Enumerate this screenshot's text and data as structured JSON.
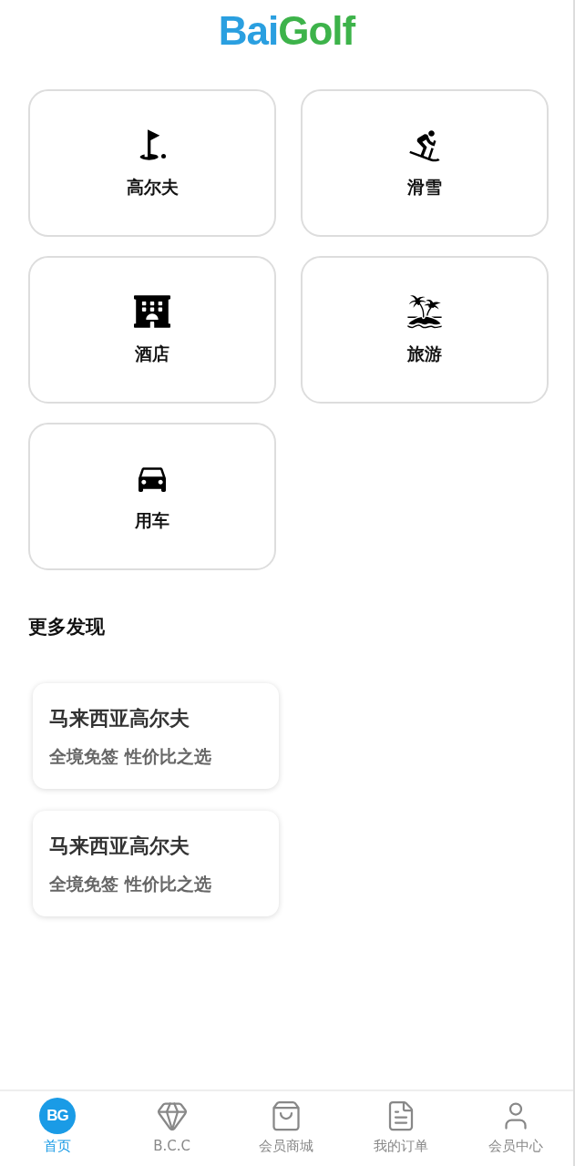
{
  "logo": [
    {
      "text": "Bai",
      "color": "#2a9fe0"
    },
    {
      "text": "Golf",
      "color": "#3db34a"
    }
  ],
  "categories": [
    {
      "label": "高尔夫"
    },
    {
      "label": "滑雪"
    },
    {
      "label": "酒店"
    },
    {
      "label": "旅游"
    },
    {
      "label": "用车"
    }
  ],
  "section_title": "更多发现",
  "promos": [
    {
      "title": "马来西亚高尔夫",
      "subtitle": "全境免签 性价比之选"
    },
    {
      "title": "马来西亚高尔夫",
      "subtitle": "全境免签 性价比之选"
    }
  ],
  "tab_bar": [
    {
      "label": "首页",
      "badge": "BG",
      "selected": true
    },
    {
      "label": "B.C.C",
      "selected": false
    },
    {
      "label": "会员商城",
      "selected": false
    },
    {
      "label": "我的订单",
      "selected": false
    },
    {
      "label": "会员中心",
      "selected": false
    }
  ]
}
